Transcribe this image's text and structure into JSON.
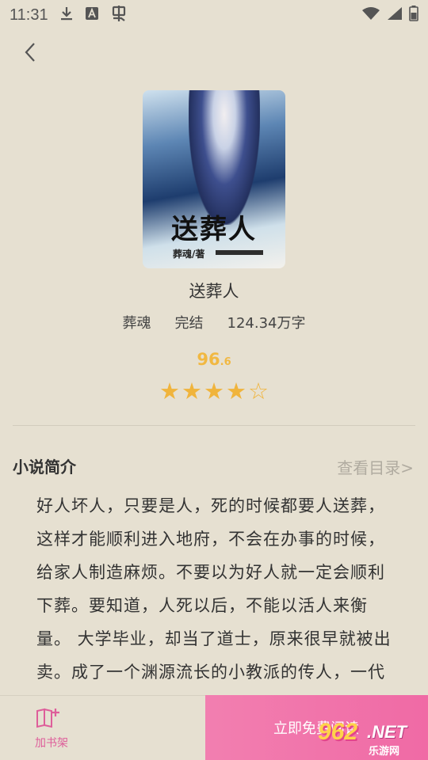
{
  "status_bar": {
    "time": "11:31"
  },
  "book": {
    "title": "送葬人",
    "author": "葬魂",
    "status": "完结",
    "word_count": "124.34万字",
    "cover_title": "送葬人",
    "cover_author": "葬魂/著"
  },
  "rating": {
    "score_int": "96",
    "score_dec": ".6",
    "stars_filled": 4,
    "stars_total": 5
  },
  "intro": {
    "section_title": "小说简介",
    "catalog_link": "查看目录>",
    "text": "好人坏人，只要是人，死的时候都要人送葬，这样才能顺利进入地府，不会在办事的时候，给家人制造麻烦。不要以为好人就一定会顺利下葬。要知道，人死以后，不能以活人来衡量。 大学毕业，却当了道士，原来很早就被出卖。成了一个渊源流长的小教派的传人，一代代的传承下来，注定的道路。"
  },
  "bottom_bar": {
    "add_shelf_label": "加书架",
    "read_label": "立即免费阅读"
  },
  "watermark": {
    "number": "962",
    "net": ".NET",
    "sub": "乐游网"
  },
  "colors": {
    "background": "#e6e0d1",
    "star": "#f0b43c",
    "accent_pink": "#f06aa5",
    "score": "#f1b842"
  }
}
